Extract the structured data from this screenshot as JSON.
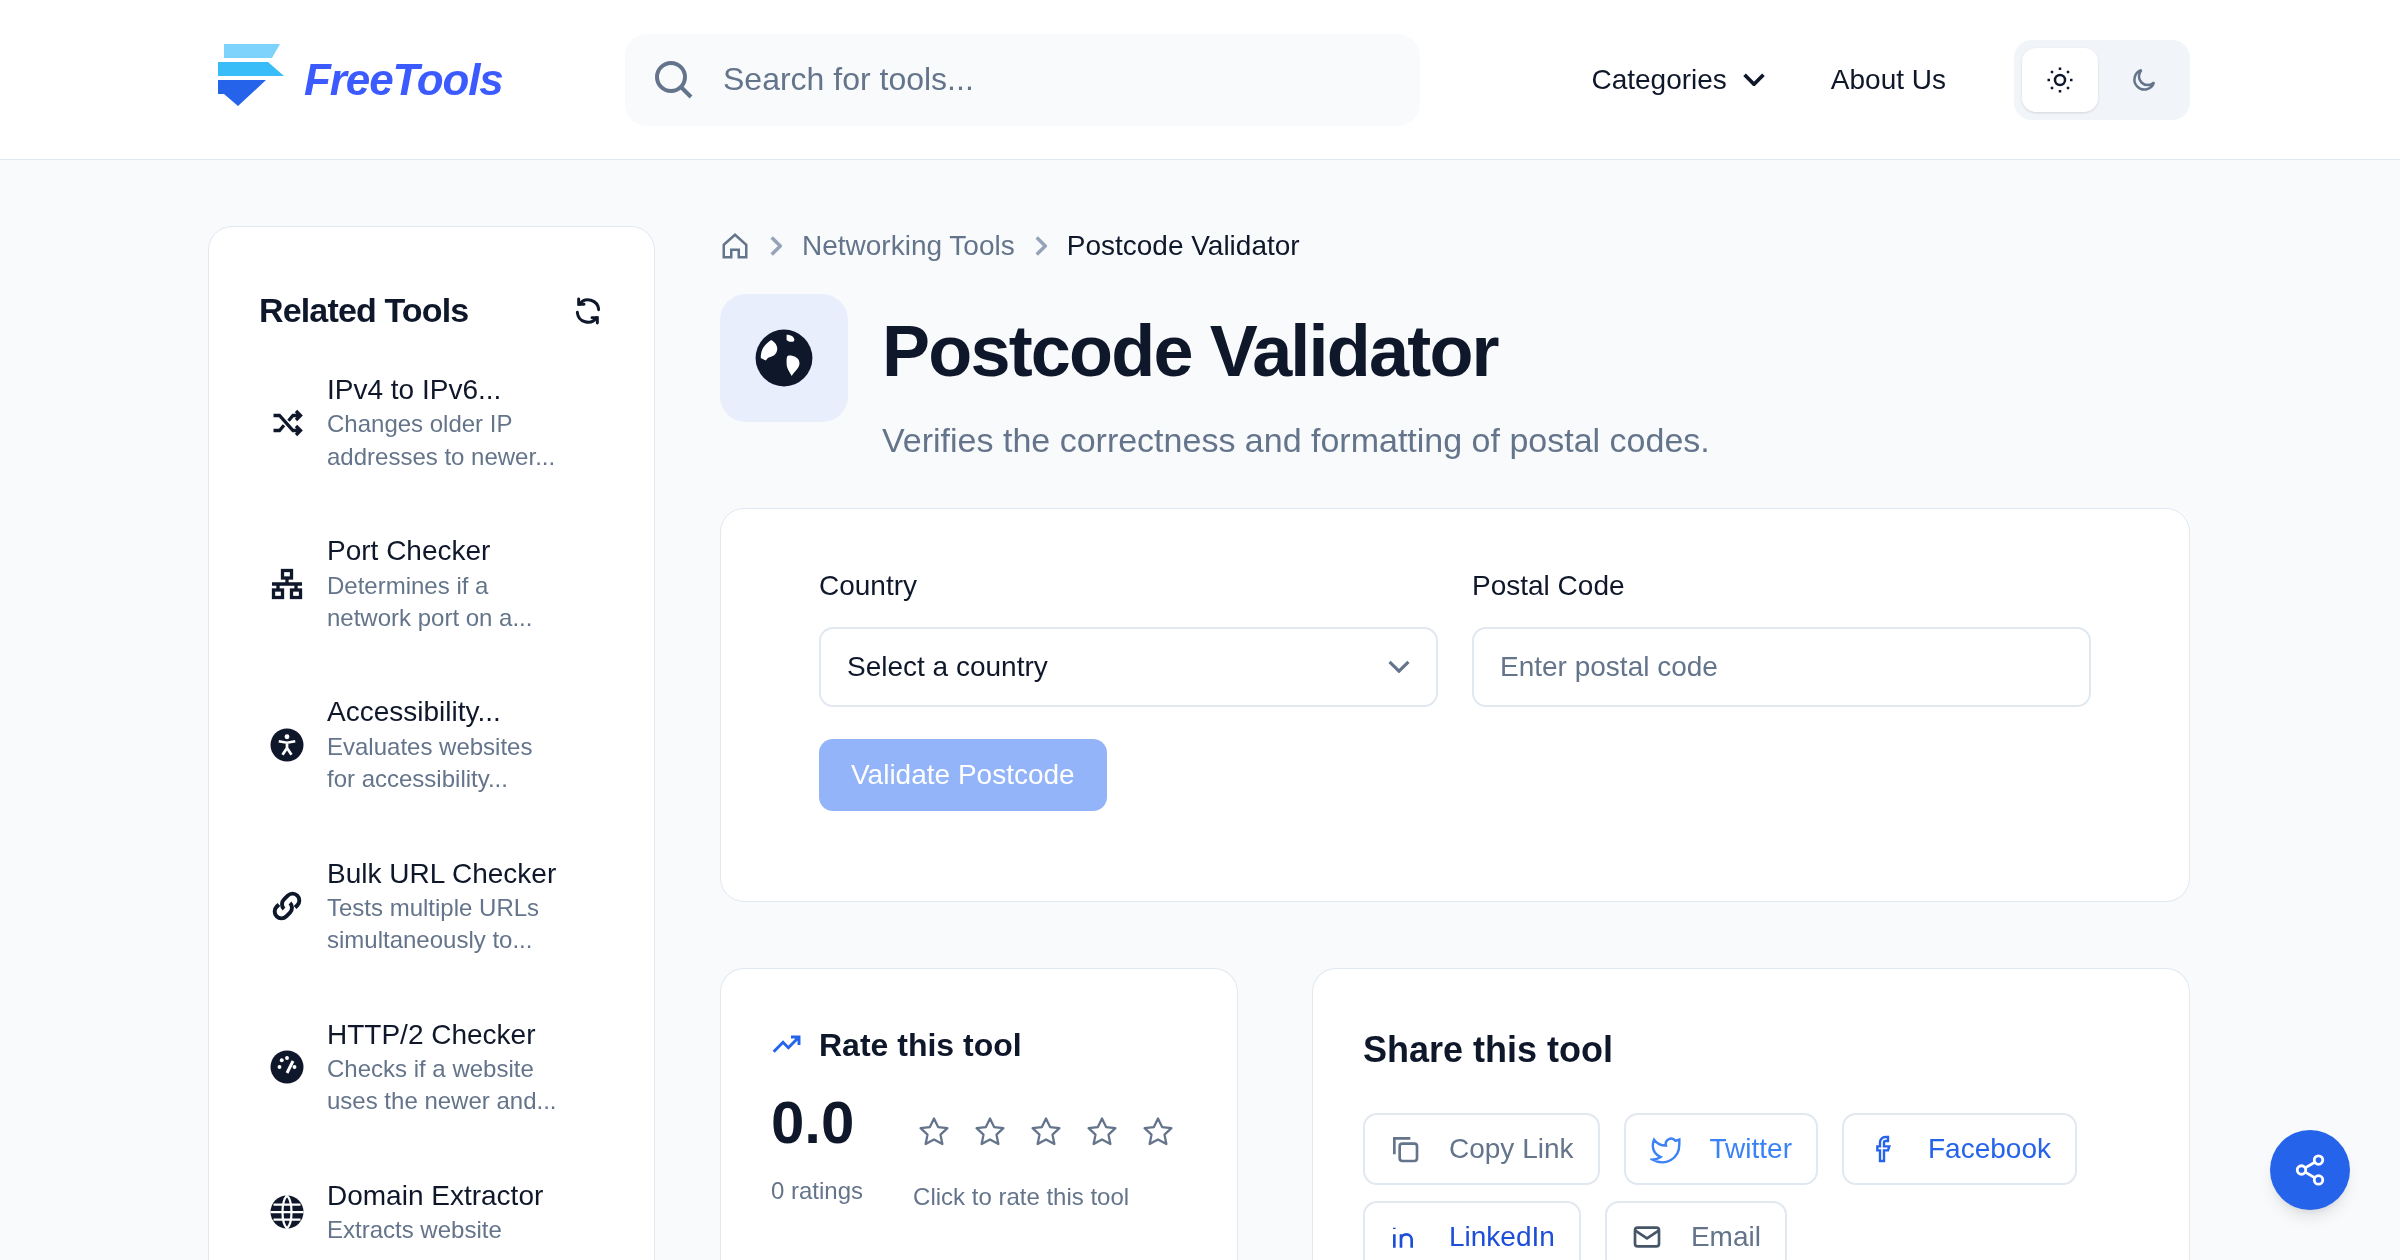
{
  "header": {
    "logo": "FreeTools",
    "search": {
      "placeholder": "Search for tools..."
    },
    "nav": [
      "Categories",
      "About Us"
    ],
    "theme_toggle": [
      {
        "kind": "light",
        "selected": true
      },
      {
        "kind": "dark",
        "selected": false
      }
    ]
  },
  "sidebar": {
    "title": "Related Tools",
    "items": [
      {
        "kind": "shuffle",
        "title": "IPv4 to IPv6...",
        "description": [
          "Changes older IP",
          "addresses to newer..."
        ]
      },
      {
        "kind": "network",
        "title": "Port Checker",
        "description": [
          "Determines if a",
          "network port on a..."
        ]
      },
      {
        "kind": "accessibility",
        "title": "Accessibility...",
        "description": [
          "Evaluates websites",
          "for accessibility..."
        ]
      },
      {
        "kind": "link",
        "title": "Bulk URL Checker",
        "description": [
          "Tests multiple URLs",
          "simultaneously to..."
        ]
      },
      {
        "kind": "gauge",
        "title": "HTTP/2 Checker",
        "description": [
          "Checks if a website",
          "uses the newer and..."
        ]
      },
      {
        "kind": "globe",
        "title": "Domain Extractor",
        "description": [
          "Extracts website"
        ]
      }
    ]
  },
  "breadcrumb": [
    "Networking Tools",
    "Postcode Validator"
  ],
  "tool": {
    "title": "Postcode Validator",
    "subtitle": "Verifies the correctness and formatting of postal codes."
  },
  "form": {
    "fields": [
      {
        "kind": "select",
        "label": "Country",
        "value": "Select a country"
      },
      {
        "kind": "text",
        "label": "Postal Code",
        "placeholder": "Enter postal code"
      }
    ],
    "button": {
      "label": "Validate Postcode",
      "disabled": true
    }
  },
  "rating": {
    "title": "Rate this tool",
    "score": "0.0",
    "count": "0 ratings",
    "stars": 0,
    "hint": "Click to rate this tool"
  },
  "share": {
    "title": "Share this tool",
    "buttons": [
      {
        "kind": "copy",
        "label": "Copy Link"
      },
      {
        "kind": "twitter",
        "label": "Twitter"
      },
      {
        "kind": "facebook",
        "label": "Facebook"
      },
      {
        "kind": "linkedin",
        "label": "LinkedIn"
      },
      {
        "kind": "email",
        "label": "Email"
      }
    ]
  }
}
